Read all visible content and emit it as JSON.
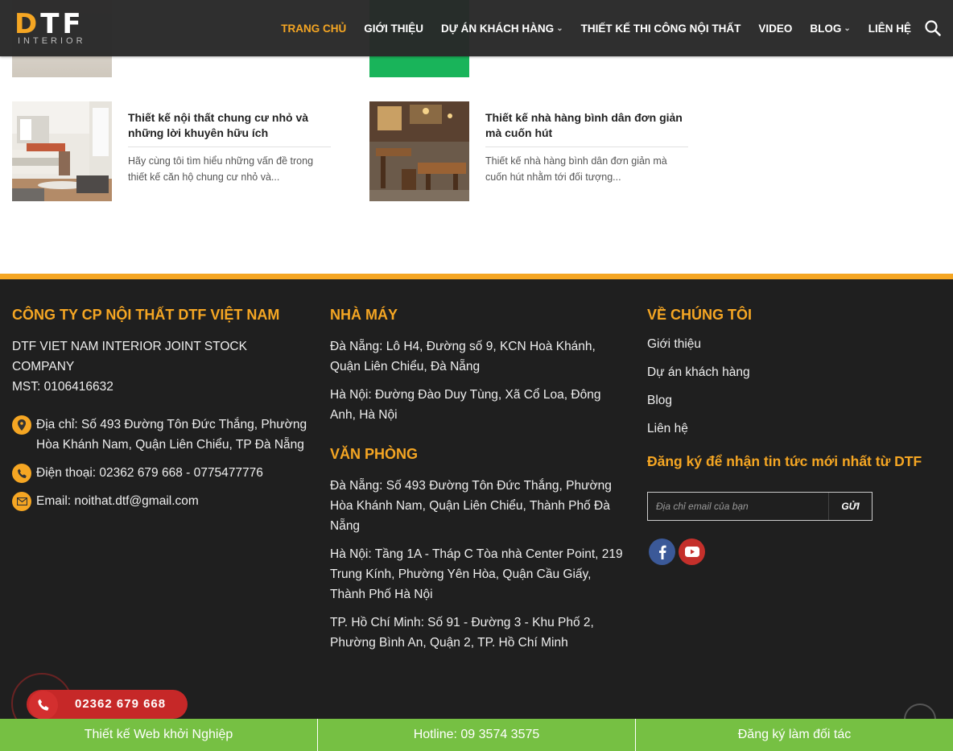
{
  "header": {
    "logo_main": "DTF",
    "logo_sub": "INTERIOR",
    "nav": [
      {
        "label": "TRANG CHỦ",
        "active": true
      },
      {
        "label": "GIỚI THIỆU"
      },
      {
        "label": "DỰ ÁN KHÁCH HÀNG",
        "dropdown": true
      },
      {
        "label": "THIẾT KẾ THI CÔNG NỘI THẤT"
      },
      {
        "label": "VIDEO"
      },
      {
        "label": "BLOG",
        "dropdown": true
      },
      {
        "label": "LIÊN HỆ"
      }
    ],
    "search_icon": "search-icon"
  },
  "posts": [
    {
      "title": "Thiết kế nội thất chung cư nhỏ và những lời khuyên hữu ích",
      "excerpt": "Hãy cùng tôi tìm hiểu những vấn đề trong thiết kế căn hộ chung cư nhỏ và..."
    },
    {
      "title": "Thiết kế nhà hàng bình dân đơn giản mà cuốn hút",
      "excerpt": "Thiết kế nhà hàng bình dân đơn giản mà cuốn hút nhằm tới đối tượng..."
    }
  ],
  "footer": {
    "company": {
      "heading": "CÔNG TY CP NỘI THẤT DTF VIỆT NAM",
      "name_en": "DTF VIET NAM INTERIOR JOINT STOCK COMPANY",
      "tax": "MST: 0106416632",
      "address": "Địa chỉ: Số 493 Đường Tôn Đức Thắng, Phường Hòa Khánh Nam, Quận Liên Chiểu, TP Đà Nẵng",
      "phone": "Điện thoại: 02362 679 668 - 0775477776",
      "email": "Email: noithat.dtf@gmail.com"
    },
    "factory": {
      "heading": "NHÀ MÁY",
      "items": [
        "Đà Nẵng: Lô H4, Đường số 9, KCN Hoà Khánh, Quận Liên Chiểu, Đà Nẵng",
        "Hà Nội: Đường Đào Duy Tùng, Xã Cổ Loa, Đông Anh, Hà Nội"
      ]
    },
    "office": {
      "heading": "VĂN PHÒNG",
      "items": [
        "Đà Nẵng: Số 493 Đường Tôn Đức Thắng, Phường Hòa Khánh Nam, Quận Liên Chiểu, Thành Phố Đà Nẵng",
        "Hà Nội: Tầng 1A - Tháp C Tòa nhà Center Point, 219 Trung Kính, Phường Yên Hòa, Quận Cầu Giấy, Thành Phố Hà Nội",
        "TP. Hồ Chí Minh: Số 91 - Đường 3 - Khu Phố 2, Phường Bình An, Quận 2, TP. Hồ Chí Minh"
      ]
    },
    "about": {
      "heading": "VỀ CHÚNG TÔI",
      "links": [
        "Giới thiệu",
        "Dự án khách hàng",
        "Blog",
        "Liên hệ"
      ],
      "subscribe_heading": "Đăng ký để nhận tin tức mới nhất từ DTF",
      "email_placeholder": "Địa chỉ email của bạn",
      "submit_label": "GỬI"
    }
  },
  "hotline_widget": {
    "number": "02362 679 668"
  },
  "bottom_bar": [
    "Thiết kế Web khởi Nghiệp",
    "Hotline: 09 3574 3575",
    "Đăng ký làm đối tác"
  ],
  "colors": {
    "accent": "#f5a623",
    "footer_bg": "#1f1f1f",
    "bottom_bar": "#76c043",
    "hotline": "#c62828"
  }
}
